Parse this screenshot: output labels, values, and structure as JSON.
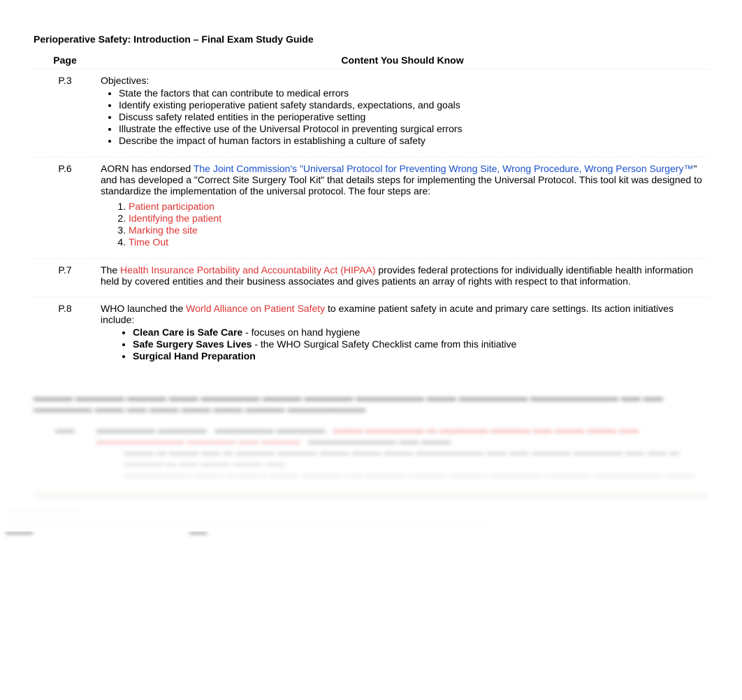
{
  "title": "Perioperative Safety: Introduction – Final Exam Study Guide",
  "headers": {
    "page": "Page",
    "content": "Content You Should Know"
  },
  "rows": {
    "r0": {
      "page": "P.3",
      "lead": "Objectives:",
      "bullets": [
        "State the factors that can contribute to medical errors",
        "Identify existing perioperative patient safety standards, expectations, and goals",
        "Discuss safety related entities in the perioperative setting",
        "Illustrate the effective use of the Universal Protocol in preventing surgical errors",
        "Describe the impact of human factors in establishing a culture of safety"
      ]
    },
    "r1": {
      "page": "P.6",
      "pre": "AORN has endorsed ",
      "link": "The Joint Commission's \"Universal Protocol for Preventing Wrong Site, Wrong Procedure, Wrong Person Surgery™",
      "post": "\" and has developed a \"Correct Site Surgery Tool Kit\" that details steps for implementing the Universal Protocol. This tool kit was designed to standardize the implementation of the universal protocol. The four steps are:",
      "steps": [
        "Patient participation",
        "Identifying the patient",
        "Marking the site",
        "Time Out"
      ]
    },
    "r2": {
      "page": "P.7",
      "pre": "The ",
      "red": "Health Insurance Portability and Accountability Act (HIPAA)",
      "post": " provides federal protections for individually identifiable health information held by covered entities and their business associates and gives patients an array of rights with respect to that information."
    },
    "r3": {
      "page": "P.8",
      "pre": "WHO launched the ",
      "red": "World Alliance on Patient Safety",
      "post": " to examine patient safety in acute and primary care settings. Its action initiatives include:",
      "items": [
        {
          "bold": "Clean Care is Safe Care",
          "rest": " - focuses on hand hygiene"
        },
        {
          "bold": "Safe Surgery Saves Lives",
          "rest": " - the WHO Surgical Safety Checklist came from this initiative"
        },
        {
          "bold": "Surgical Hand Preparation",
          "rest": ""
        }
      ]
    }
  }
}
